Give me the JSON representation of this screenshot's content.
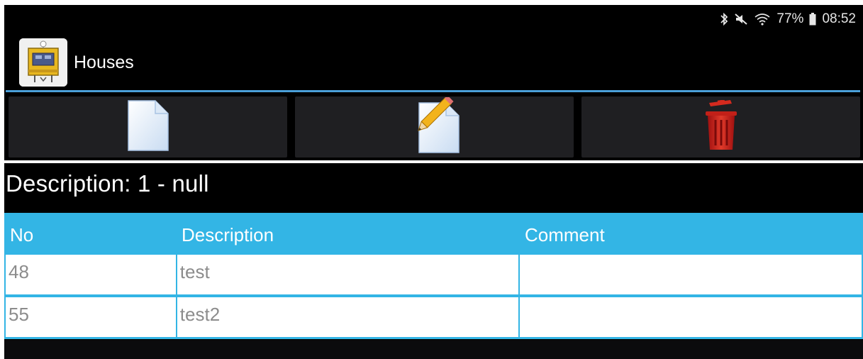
{
  "status_bar": {
    "battery": "77%",
    "time": "08:52",
    "icons": [
      "bluetooth-icon",
      "mute-icon",
      "wifi-icon",
      "battery-icon"
    ]
  },
  "app_bar": {
    "title": "Houses",
    "icon": "house-app-icon"
  },
  "toolbar": {
    "buttons": [
      {
        "name": "new",
        "icon": "new-document-icon"
      },
      {
        "name": "edit",
        "icon": "edit-document-icon"
      },
      {
        "name": "delete",
        "icon": "trash-icon"
      }
    ]
  },
  "description": {
    "text": "Description: 1 - null"
  },
  "table": {
    "columns": [
      "No",
      "Description",
      "Comment"
    ],
    "rows": [
      {
        "no": "48",
        "description": "test",
        "comment": ""
      },
      {
        "no": "55",
        "description": "test2",
        "comment": ""
      }
    ]
  },
  "colors": {
    "accent": "#33b5e5",
    "rule": "#4a9fd8",
    "background": "#000000",
    "delete_red": "#d42a1e"
  }
}
